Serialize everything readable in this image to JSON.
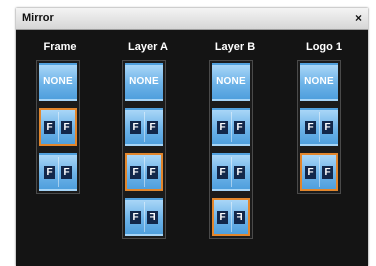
{
  "window": {
    "title": "Mirror",
    "close_label": "×"
  },
  "options": {
    "none_label": "NONE",
    "glyph": "F"
  },
  "columns": [
    {
      "label": "Frame",
      "items": [
        "none",
        "horizontal",
        "vertical"
      ],
      "selected": 1
    },
    {
      "label": "Layer A",
      "items": [
        "none",
        "horizontal",
        "vertical",
        "both"
      ],
      "selected": 2
    },
    {
      "label": "Layer B",
      "items": [
        "none",
        "horizontal",
        "vertical",
        "both"
      ],
      "selected": 3
    },
    {
      "label": "Logo 1",
      "items": [
        "none",
        "horizontal",
        "vertical"
      ],
      "selected": 2
    }
  ],
  "colors": {
    "selected_border": "#e2862c",
    "tile": "#6db3e8",
    "background": "#141414"
  }
}
